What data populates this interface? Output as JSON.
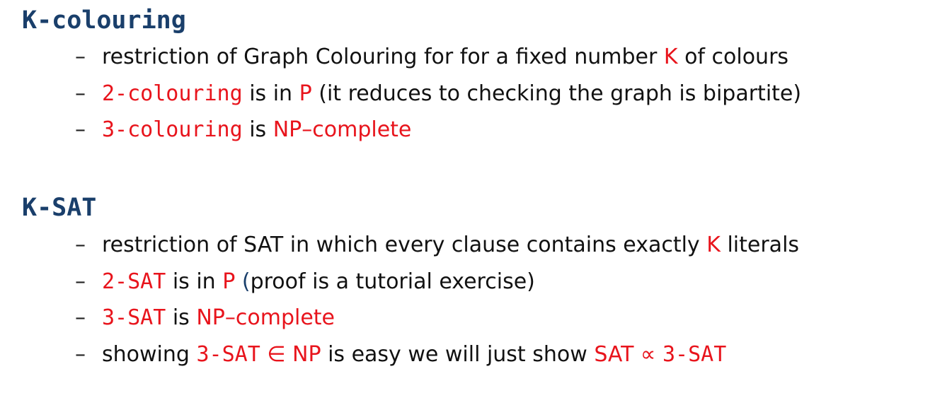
{
  "colors": {
    "heading": "#1a3f6b",
    "highlight": "#e8141c",
    "text": "#111111"
  },
  "kcolouring": {
    "title": "K-colouring",
    "items": [
      {
        "dash": "–",
        "parts": [
          "restriction of Graph Colouring for for a fixed number ",
          "K",
          " of colours"
        ]
      },
      {
        "dash": "–",
        "parts": [
          "2-colouring",
          " is in ",
          "P",
          " (it reduces to checking the graph is bipartite)"
        ]
      },
      {
        "dash": "–",
        "parts": [
          "3-colouring",
          " is ",
          "NP–complete"
        ]
      }
    ]
  },
  "ksat": {
    "title": "K-SAT",
    "items": [
      {
        "dash": "–",
        "parts": [
          "restriction of SAT in which every clause contains exactly ",
          "K",
          " literals"
        ]
      },
      {
        "dash": "–",
        "parts": [
          "2-SAT",
          " is in ",
          "P",
          " (",
          "proof is a tutorial exercise)"
        ]
      },
      {
        "dash": "–",
        "parts": [
          "3-SAT",
          " is ",
          "NP–complete"
        ]
      },
      {
        "dash": "–",
        "parts": [
          "showing ",
          "3-SAT",
          " ∈ ",
          "NP",
          " is easy we will just show ",
          "SAT",
          " ∝ ",
          "3-SAT"
        ]
      }
    ]
  }
}
